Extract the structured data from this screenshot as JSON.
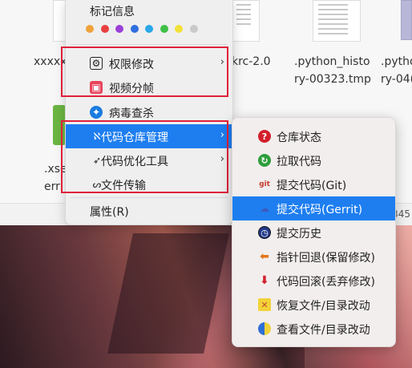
{
  "file_manager": {
    "files": [
      {
        "name_line1": "xxxxx",
        "name_line2": ""
      },
      {
        "name_line1": "krc-2.0",
        "name_line2": ""
      },
      {
        "name_line1": ".python_histo",
        "name_line2": "ry-00323.tmp"
      },
      {
        "name_line1": ".pytho",
        "name_line2": "ry-04("
      },
      {
        "name_line1": ".xse",
        "name_line2": "err"
      }
    ],
    "status_text": "345"
  },
  "context_menu": {
    "mark_title": "标记信息",
    "color_tags": [
      "#f0a23a",
      "#e84040",
      "#9b3fd8",
      "#2f6fe0",
      "#2aa7e8",
      "#3fbf46",
      "#f2e13a",
      "#c9c9c9"
    ],
    "items": [
      {
        "label": "权限修改",
        "icon": "permission-icon",
        "has_submenu": true
      },
      {
        "label": "视频分帧",
        "icon": "video-frame-icon",
        "has_submenu": false
      },
      {
        "label": "病毒查杀",
        "icon": "virus-scan-icon",
        "has_submenu": false
      },
      {
        "label": "代码仓库管理",
        "icon": "repo-icon",
        "icon_glyph": "ℵ",
        "has_submenu": true,
        "highlighted": true
      },
      {
        "label": "代码优化工具",
        "icon": "optimize-icon",
        "icon_glyph": "➶",
        "has_submenu": true
      },
      {
        "label": "文件传输",
        "icon": "transfer-icon",
        "icon_glyph": "ᔕ",
        "has_submenu": false
      },
      {
        "label": "属性(R)",
        "icon": "",
        "has_submenu": false
      }
    ]
  },
  "submenu": {
    "items": [
      {
        "label": "仓库状态",
        "icon": "repo-status-icon",
        "glyph": "?"
      },
      {
        "label": "拉取代码",
        "icon": "pull-code-icon",
        "glyph": "↻"
      },
      {
        "label": "提交代码(Git)",
        "icon": "git-commit-icon",
        "glyph": "git"
      },
      {
        "label": "提交代码(Gerrit)",
        "icon": "gerrit-commit-icon",
        "glyph": "☁",
        "highlighted": true
      },
      {
        "label": "提交历史",
        "icon": "commit-history-icon",
        "glyph": "◷"
      },
      {
        "label": "指针回退(保留修改)",
        "icon": "soft-reset-icon",
        "glyph": "⬅"
      },
      {
        "label": "代码回滚(丢弃修改)",
        "icon": "revert-icon",
        "glyph": "⬇"
      },
      {
        "label": "恢复文件/目录改动",
        "icon": "restore-icon",
        "glyph": "✕"
      },
      {
        "label": "查看文件/目录改动",
        "icon": "view-diff-icon",
        "glyph": "◐"
      }
    ]
  }
}
